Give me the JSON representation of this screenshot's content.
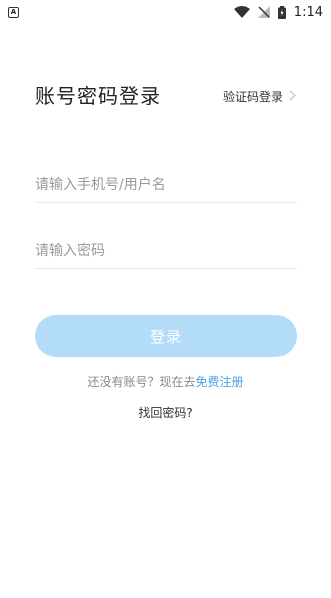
{
  "status_bar": {
    "time": "1:14",
    "notification_icon": "notification-a-icon",
    "wifi_icon": "wifi-icon",
    "signal_icon": "no-signal-icon",
    "battery_icon": "battery-charging-icon"
  },
  "header": {
    "title": "账号密码登录",
    "switch_label": "验证码登录"
  },
  "form": {
    "username_placeholder": "请输入手机号/用户名",
    "username_value": "",
    "password_placeholder": "请输入密码",
    "password_value": "",
    "login_label": "登录"
  },
  "footer": {
    "register_prompt": "还没有账号？现在去",
    "register_link": "免费注册",
    "forgot_password": "找回密码?"
  },
  "colors": {
    "login_button_bg": "#b3dcf9",
    "link_color": "#4a9fe8"
  }
}
